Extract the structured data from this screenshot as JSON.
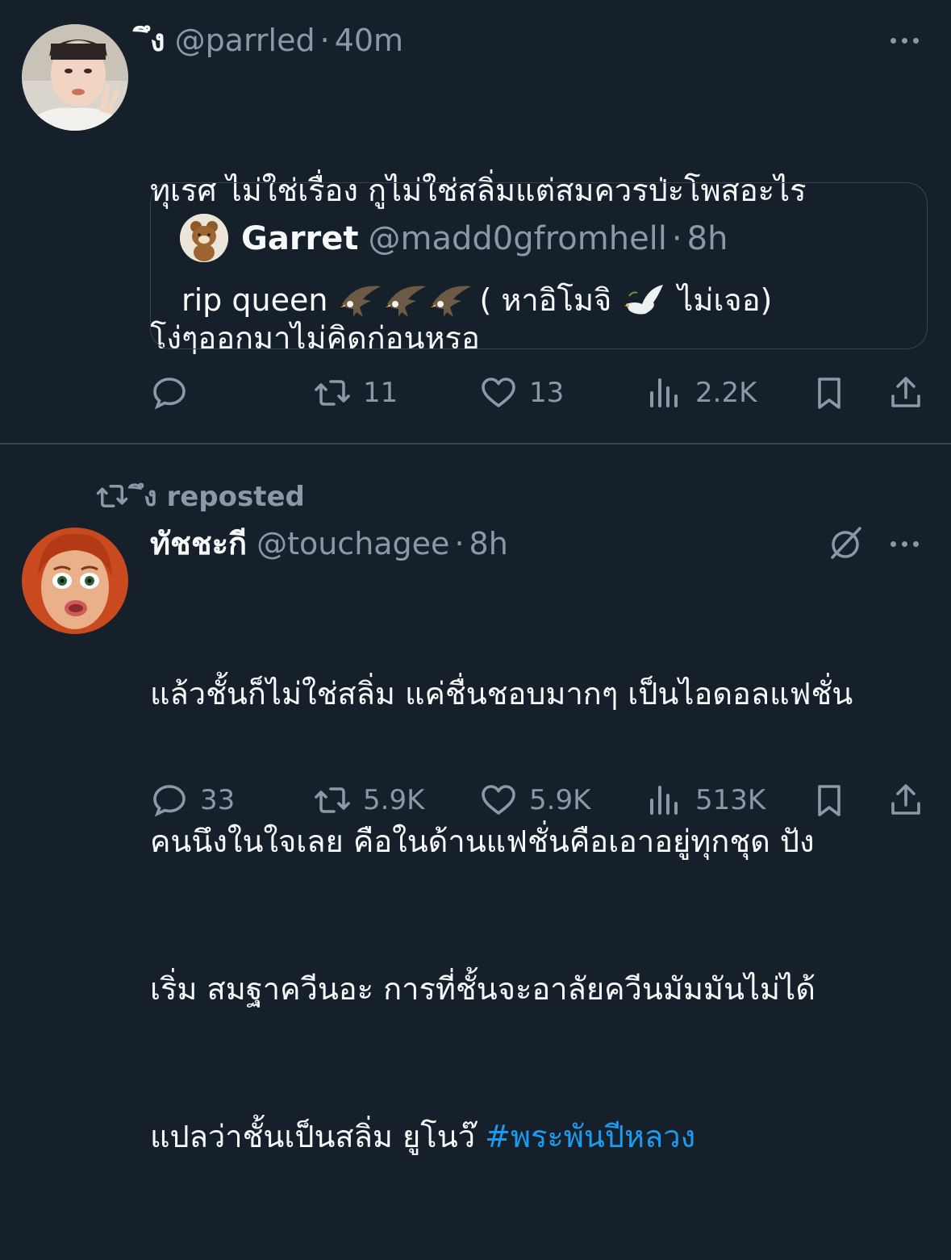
{
  "tweet1": {
    "name": "ึง",
    "handle": "@parrled",
    "dot": "·",
    "time": "40m",
    "text_line1": "ทุเรศ ไม่ใช่เรื่อง กูไม่ใช่สลิ่มแต่สมควรป่ะโพสอะไร",
    "text_line2": "โง่ๆออกมาไม่คิดก่อนหรอ",
    "quote": {
      "name": "Garret",
      "handle": "@madd0gfromhell",
      "dot": "·",
      "time": "8h",
      "text_start": "rip queen",
      "text_mid": "( หาอิโมจิ",
      "text_end": "ไม่เจอ)"
    },
    "actions": {
      "reply_count": "",
      "retweet_count": "11",
      "like_count": "13",
      "views_count": "2.2K"
    }
  },
  "repost": {
    "label": "ึง reposted"
  },
  "tweet2": {
    "name": "ทัชชะกี",
    "handle": "@touchagee",
    "dot": "·",
    "time": "8h",
    "text_line1": "แล้วชั้นก็ไม่ใช่สลิ่ม แค่ชื่นชอบมากๆ เป็นไอดอลแฟชั่น",
    "text_line2": "คนนึงในใจเลย คือในด้านแฟชั่นคือเอาอยู่ทุกชุด ปัง",
    "text_line3": "เริ่ม สมฐาควีนอะ การที่ชั้นจะอาลัยควีนมัมมันไม่ได้",
    "text_line4_start": "แปลว่าชั้นเป็นสลิ่ม ยูโนว๊ ",
    "hashtag": "#พระพันปีหลวง",
    "actions": {
      "reply_count": "33",
      "retweet_count": "5.9K",
      "like_count": "5.9K",
      "views_count": "513K"
    }
  },
  "colors": {
    "background": "#15202b",
    "text": "#f7f9f9",
    "muted": "#8b98a5",
    "accent": "#1d9bf0",
    "border": "#38444d"
  }
}
